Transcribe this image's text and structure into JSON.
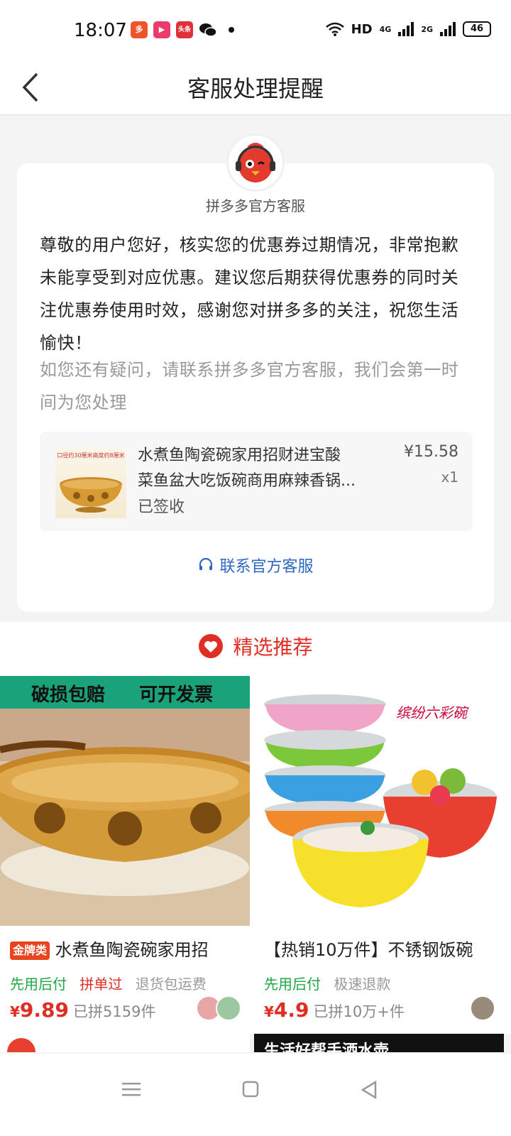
{
  "status_bar": {
    "time": "18:07",
    "app_badges": [
      {
        "icon": "pinduoduo-app-icon",
        "color": "#f0542b",
        "text": "多"
      },
      {
        "icon": "video-app-icon",
        "color": "#ec3a6a",
        "text": "▶"
      },
      {
        "icon": "toutiao-app-icon",
        "color": "#e0303a",
        "text": "头条"
      }
    ],
    "wechat_icon": "wechat-icon",
    "network": "HD",
    "signal_1": "4G",
    "signal_2": "2G",
    "battery": "46"
  },
  "header": {
    "title": "客服处理提醒",
    "back_icon": "back-arrow-icon"
  },
  "message": {
    "sender": "拼多多官方客服",
    "body": "尊敬的用户您好，核实您的优惠券过期情况，非常抱歉未能享受到对应优惠。建议您后期获得优惠券的同时关注优惠券使用时效，感谢您对拼多多的关注，祝您生活愉快！",
    "followup": "如您还有疑问，请联系拼多多官方客服，我们会第一时间为您处理",
    "order": {
      "name_line1": "水煮鱼陶瓷碗家用招财进宝酸",
      "name_line2": "菜鱼盆大吃饭碗商用麻辣香锅...",
      "status": "已签收",
      "price": "¥15.58",
      "quantity": "x1",
      "thumb_caption": "口径约30厘米高度约8厘米"
    },
    "contact_label": "联系官方客服",
    "contact_icon": "headset-icon"
  },
  "recommend": {
    "section_title": "精选推荐",
    "section_icon": "heart-icon",
    "products": [
      {
        "banner_left": "破损包赔",
        "banner_right": "可开发票",
        "badge": "金牌类",
        "title": "水煮鱼陶瓷碗家用招",
        "perk1": "先用后付",
        "perk2": "拼单过",
        "perk3": "退货包运费",
        "currency": "¥",
        "price": "9.89",
        "sold": "已拼5159件"
      },
      {
        "overlay_text": "缤纷六彩碗",
        "title": "【热销10万件】不锈钢饭碗",
        "perk1": "先用后付",
        "perk2": "极速退款",
        "currency": "¥",
        "price": "4.9",
        "sold": "已拼10万+件"
      }
    ],
    "next_row_right": "生活好帮手洒水壶"
  },
  "colors": {
    "brand_red": "#e02e24",
    "link_blue": "#2f67c4",
    "green": "#20a845"
  }
}
